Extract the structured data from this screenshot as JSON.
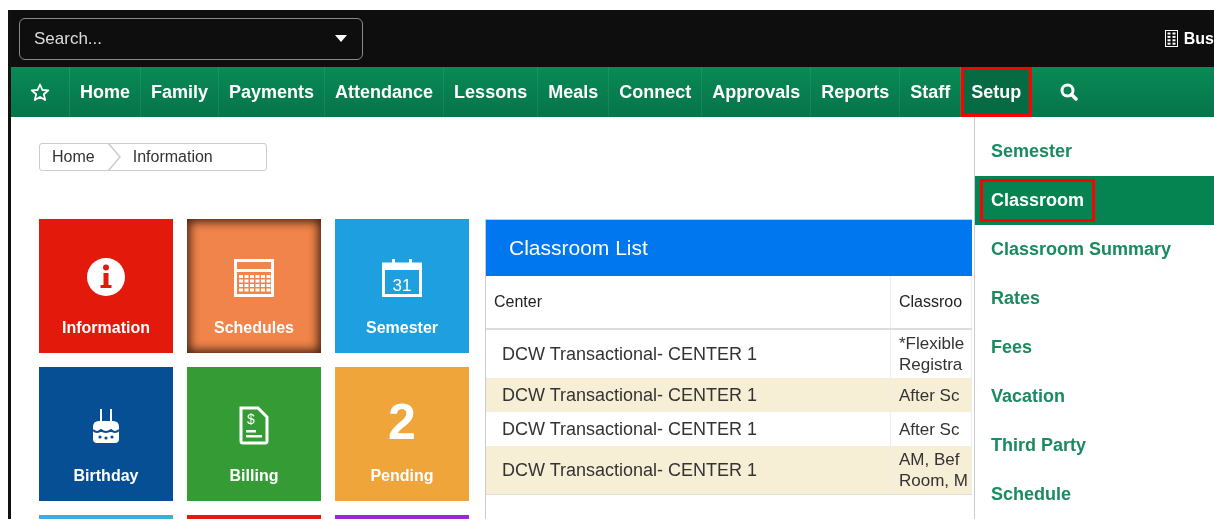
{
  "header": {
    "search": {
      "placeholder": "Search..."
    },
    "account_label": "Bus"
  },
  "nav": {
    "items": [
      {
        "label": "Home",
        "selected": false,
        "highlighted": false
      },
      {
        "label": "Family",
        "selected": false,
        "highlighted": false
      },
      {
        "label": "Payments",
        "selected": false,
        "highlighted": false
      },
      {
        "label": "Attendance",
        "selected": false,
        "highlighted": false
      },
      {
        "label": "Lessons",
        "selected": false,
        "highlighted": false
      },
      {
        "label": "Meals",
        "selected": false,
        "highlighted": false
      },
      {
        "label": "Connect",
        "selected": false,
        "highlighted": false
      },
      {
        "label": "Approvals",
        "selected": false,
        "highlighted": false
      },
      {
        "label": "Reports",
        "selected": false,
        "highlighted": false
      },
      {
        "label": "Staff",
        "selected": false,
        "highlighted": false
      },
      {
        "label": "Setup",
        "selected": true,
        "highlighted": true
      }
    ]
  },
  "breadcrumb": [
    "Home",
    "Information"
  ],
  "tiles": [
    {
      "kind": "info",
      "label": "Information",
      "color": "#e31a0b",
      "selected": false
    },
    {
      "kind": "schedule",
      "label": "Schedules",
      "color": "#f0844a",
      "selected": true
    },
    {
      "kind": "calendar",
      "label": "Semester",
      "color": "#1e9fe0",
      "selected": false,
      "icon_text": "31"
    },
    {
      "kind": "cake",
      "label": "Birthday",
      "color": "#064f94",
      "selected": false
    },
    {
      "kind": "invoice",
      "label": "Billing",
      "color": "#359b35",
      "selected": false,
      "icon_text": "$"
    },
    {
      "kind": "count",
      "label": "Pending",
      "color": "#f0a53a",
      "selected": false,
      "count": "2"
    },
    {
      "kind": "stub",
      "color": "#39aee0"
    },
    {
      "kind": "stub",
      "color": "#e31a0b"
    },
    {
      "kind": "stub",
      "color": "#9b27d8"
    }
  ],
  "classroom_list": {
    "title": "Classroom List",
    "columns": [
      "Center",
      "Classroo"
    ],
    "rows": [
      {
        "cells": [
          "DCW Transactional- CENTER 1",
          "*Flexible\nRegistra"
        ]
      },
      {
        "cells": [
          "DCW Transactional- CENTER 1",
          "After Sc"
        ]
      },
      {
        "cells": [
          "DCW Transactional- CENTER 1",
          "After Sc"
        ]
      },
      {
        "cells": [
          "DCW Transactional- CENTER 1",
          "AM, Bef\nRoom, M"
        ]
      }
    ]
  },
  "setup_menu": {
    "items": [
      {
        "label": "Semester",
        "selected": false,
        "highlighted": false
      },
      {
        "label": "Classroom",
        "selected": true,
        "highlighted": true
      },
      {
        "label": "Classroom Summary",
        "selected": false,
        "highlighted": false
      },
      {
        "label": "Rates",
        "selected": false,
        "highlighted": false
      },
      {
        "label": "Fees",
        "selected": false,
        "highlighted": false
      },
      {
        "label": "Vacation",
        "selected": false,
        "highlighted": false
      },
      {
        "label": "Third Party",
        "selected": false,
        "highlighted": false
      },
      {
        "label": "Schedule",
        "selected": false,
        "highlighted": false
      }
    ]
  }
}
